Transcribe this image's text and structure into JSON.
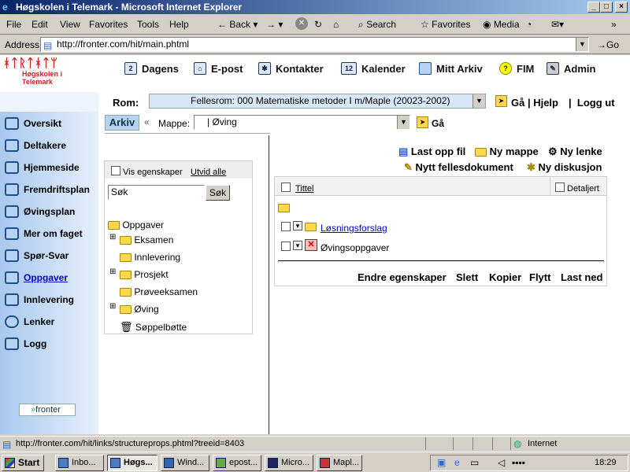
{
  "window": {
    "title": "Høgskolen i Telemark - Microsoft Internet Explorer"
  },
  "menubar": {
    "items": [
      "File",
      "Edit",
      "View",
      "Favorites",
      "Tools",
      "Help"
    ],
    "back_label": "Back",
    "search_label": "Search",
    "favorites_label": "Favorites",
    "media_label": "Media"
  },
  "address": {
    "label": "Address",
    "url": "http://fronter.com/hit/main.phtml",
    "go_label": "Go"
  },
  "brand": {
    "logo_text": "Høgskolen i Telemark"
  },
  "topnav": [
    "Dagens",
    "E-post",
    "Kontakter",
    "Kalender",
    "Mitt Arkiv",
    "FIM",
    "Admin"
  ],
  "room": {
    "label": "Rom:",
    "value": "Fellesrom: 000 Matematiske metoder I m/Maple (20023-2002)",
    "go_help": "Gå | Hjelp",
    "logout": "Logg ut"
  },
  "sidebar": {
    "items": [
      "Oversikt",
      "Deltakere",
      "Hjemmeside",
      "Fremdriftsplan",
      "Øvingsplan",
      "Mer om faget",
      "Spør-Svar",
      "Oppgaver",
      "Innlevering",
      "Lenker",
      "Logg"
    ],
    "footer_logo": "fronter"
  },
  "archive": {
    "tab": "Arkiv",
    "folder_label": "Mappe:",
    "folder_value": "|  Øving",
    "go": "Gå"
  },
  "tree": {
    "show_props": "Vis egenskaper",
    "expand_all": "Utvid alle",
    "search_value": "Søk",
    "search_button": "Søk",
    "root": "Oppgaver",
    "children": [
      "Eksamen",
      "Innlevering",
      "Prosjekt",
      "Prøveeksamen",
      "Øving",
      "Søppelbøtte"
    ]
  },
  "actions": {
    "upload": "Last opp fil",
    "new_folder": "Ny mappe",
    "new_link": "Ny lenke",
    "new_doc": "Nytt fellesdokument",
    "new_discussion": "Ny diskusjon"
  },
  "list": {
    "col_title": "Tittel",
    "detailed": "Detaljert",
    "rows": [
      "Løsningsforslag",
      "Øvingsoppgaver"
    ]
  },
  "bottom_actions": [
    "Endre egenskaper",
    "Slett",
    "Kopier",
    "Flytt",
    "Last ned"
  ],
  "status": {
    "url": "http://fronter.com/hit/links/structureprops.phtml?treeid=8403",
    "zone": "Internet"
  },
  "taskbar": {
    "start": "Start",
    "tasks": [
      "Inbo...",
      "Høgs...",
      "Wind...",
      "epost...",
      "Micro...",
      "Mapl..."
    ],
    "clock": "18:29"
  }
}
